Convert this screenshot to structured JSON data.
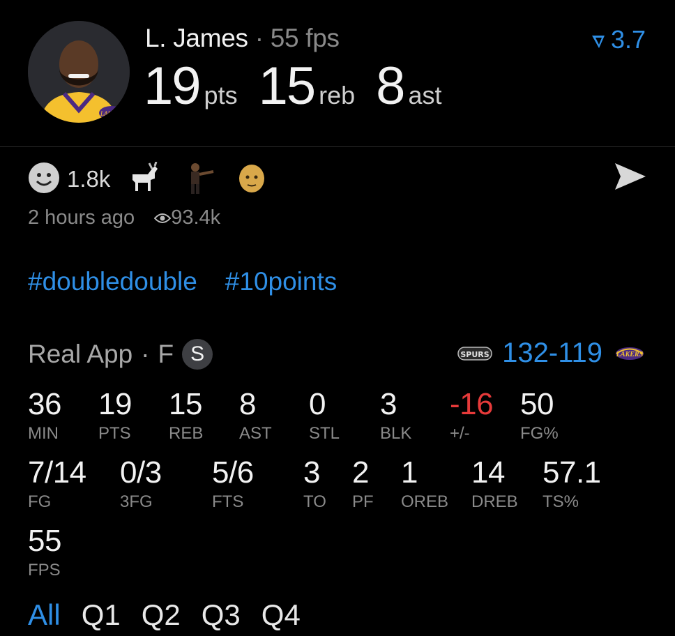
{
  "player": {
    "name": "L. James",
    "fps_label": "55 fps",
    "pts": "19",
    "pts_unit": "pts",
    "reb": "15",
    "reb_unit": "reb",
    "ast": "8",
    "ast_unit": "ast",
    "rating": "3.7"
  },
  "reactions": {
    "count": "1.8k",
    "emojis": [
      "smiley-face-icon",
      "goat-icon",
      "shrug-figure-icon",
      "bald-face-icon"
    ]
  },
  "post": {
    "time": "2 hours ago",
    "views": "93.4k"
  },
  "tags": [
    "#doubledouble",
    "#10points"
  ],
  "game": {
    "source": "Real App",
    "status": "F",
    "badge": "S",
    "score": "132-119",
    "home_logo": "SPURS",
    "away_logo": "LAKERS"
  },
  "stats_row1": [
    {
      "v": "36",
      "l": "MIN"
    },
    {
      "v": "19",
      "l": "PTS"
    },
    {
      "v": "15",
      "l": "REB"
    },
    {
      "v": "8",
      "l": "AST"
    },
    {
      "v": "0",
      "l": "STL"
    },
    {
      "v": "3",
      "l": "BLK"
    },
    {
      "v": "-16",
      "l": "+/-"
    },
    {
      "v": "50",
      "l": "FG%"
    }
  ],
  "stats_row2": [
    {
      "v": "7/14",
      "l": "FG"
    },
    {
      "v": "0/3",
      "l": "3FG"
    },
    {
      "v": "5/6",
      "l": "FTS"
    },
    {
      "v": "3",
      "l": "TO"
    },
    {
      "v": "2",
      "l": "PF"
    },
    {
      "v": "1",
      "l": "OREB"
    },
    {
      "v": "14",
      "l": "DREB"
    },
    {
      "v": "57.1",
      "l": "TS%"
    }
  ],
  "stats_row3": [
    {
      "v": "55",
      "l": "FPS"
    }
  ],
  "quarters": [
    "All",
    "Q1",
    "Q2",
    "Q3",
    "Q4"
  ],
  "colors": {
    "accent": "#2f8fe6",
    "negative": "#e63a3a",
    "lakers_gold": "#f2c230",
    "lakers_purple": "#4b2a82"
  }
}
